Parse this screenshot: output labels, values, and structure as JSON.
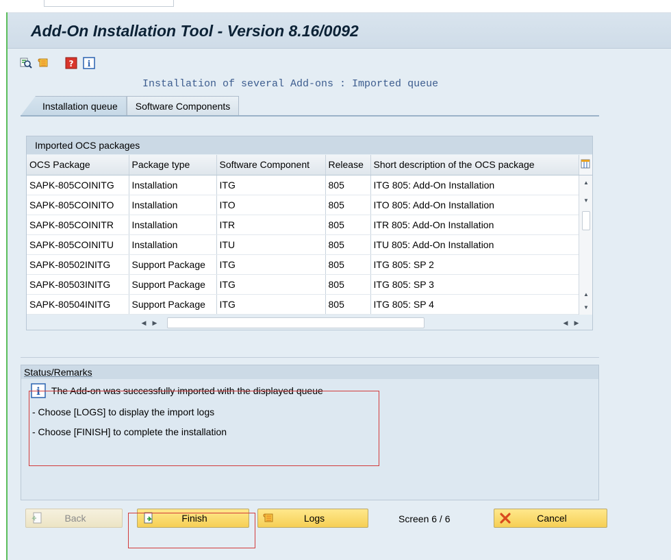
{
  "window": {
    "title": "Add-On Installation Tool - Version 8.16/0092",
    "subtitle": "Installation of several Add-ons : Imported queue"
  },
  "toolbar": {
    "icons": [
      "search-icon",
      "scroll-icon",
      "help-icon",
      "info-icon"
    ]
  },
  "tabs": [
    {
      "label": "Installation queue",
      "active": true
    },
    {
      "label": "Software Components",
      "active": false
    }
  ],
  "table": {
    "title": "Imported OCS packages",
    "columns": [
      "OCS Package",
      "Package type",
      "Software Component",
      "Release",
      "Short description of the OCS package"
    ],
    "rows": [
      [
        "SAPK-805COINITG",
        "Installation",
        "ITG",
        "805",
        "ITG 805: Add-On Installation"
      ],
      [
        "SAPK-805COINITO",
        "Installation",
        "ITO",
        "805",
        "ITO 805: Add-On Installation"
      ],
      [
        "SAPK-805COINITR",
        "Installation",
        "ITR",
        "805",
        "ITR 805: Add-On Installation"
      ],
      [
        "SAPK-805COINITU",
        "Installation",
        "ITU",
        "805",
        "ITU 805: Add-On Installation"
      ],
      [
        "SAPK-80502INITG",
        "Support Package",
        "ITG",
        "805",
        "ITG 805: SP 2"
      ],
      [
        "SAPK-80503INITG",
        "Support Package",
        "ITG",
        "805",
        "ITG 805: SP 3"
      ],
      [
        "SAPK-80504INITG",
        "Support Package",
        "ITG",
        "805",
        "ITG 805: SP 4"
      ]
    ]
  },
  "status": {
    "title": "Status/Remarks",
    "message": "The Add-on was successfully imported with the displayed queue",
    "line1": "- Choose [LOGS] to display the import logs",
    "line2": "- Choose [FINISH] to complete the installation"
  },
  "footer": {
    "back_label": "Back",
    "finish_label": "Finish",
    "logs_label": "Logs",
    "screen_label": "Screen 6 / 6",
    "cancel_label": "Cancel"
  },
  "colors": {
    "accent_yellow": "#f6cf55",
    "highlight_red": "#d23a3a",
    "title_text": "#0c2236",
    "subtitle_text": "#3c5c8e"
  }
}
